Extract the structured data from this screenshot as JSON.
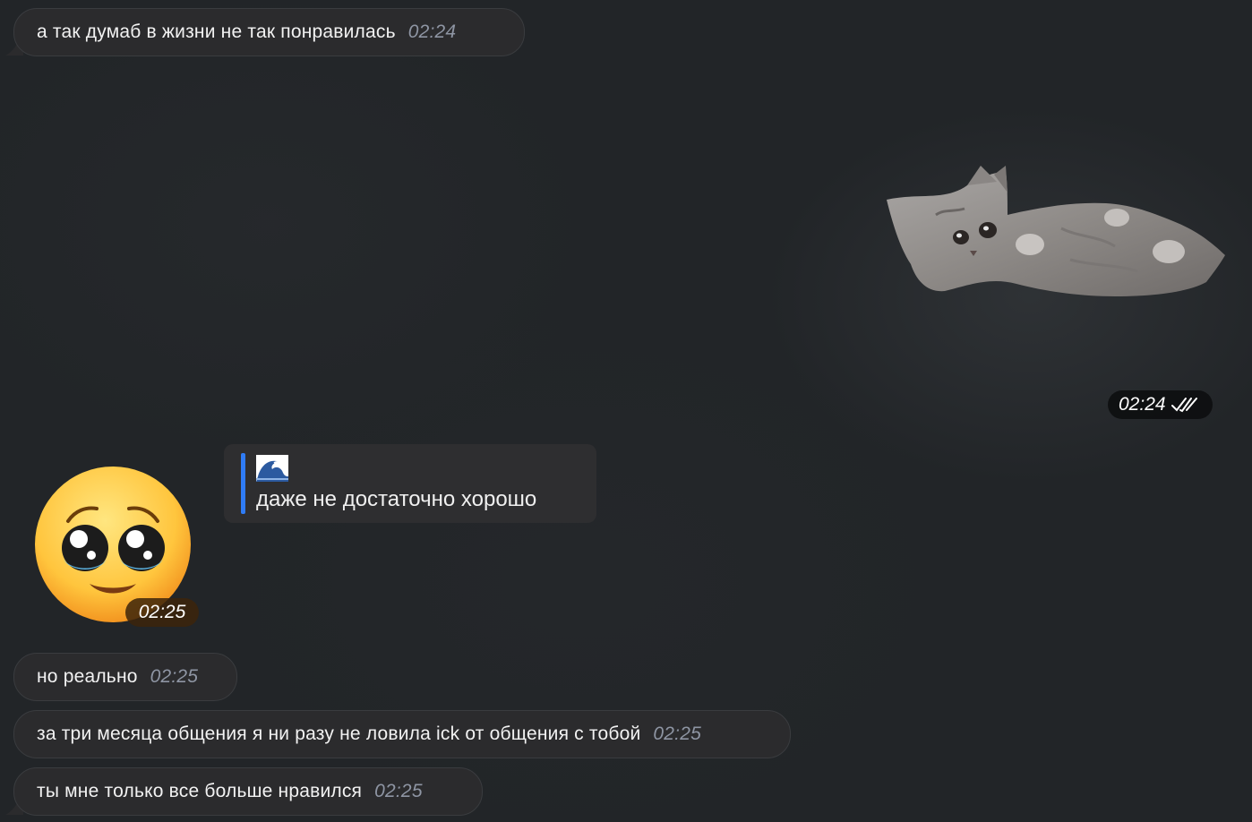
{
  "messages": [
    {
      "text": "а так думаб в жизни не так понравилась",
      "time": "02:24"
    },
    {
      "text": "но реально",
      "time": "02:25"
    },
    {
      "text": "за три месяца общения я ни разу не ловила ick от общения с тобой",
      "time": "02:25"
    },
    {
      "text": "ты мне только все больше нравился",
      "time": "02:25"
    }
  ],
  "sticker": {
    "subject": "kitten sticker",
    "time": "02:24",
    "status_icon": "double-check-icon"
  },
  "reply": {
    "quote_emoji": "wave-emoji-icon",
    "text": "даже не достаточно хорошо"
  },
  "emoji_message": {
    "emoji": "pleading-face-emoji-icon",
    "time": "02:25"
  },
  "colors": {
    "background": "#222528",
    "bubble": "#2b2b2d",
    "reply_accent": "#2f7cf6",
    "timestamp": "#8e95a3"
  }
}
